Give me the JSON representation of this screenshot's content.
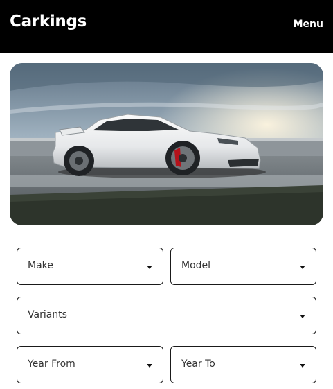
{
  "header": {
    "logo": "Carkings",
    "menu_label": "Menu",
    "background": "#000000"
  },
  "hero": {
    "image": "white-sports-car-on-race-track"
  },
  "filters": {
    "make": {
      "label": "Make"
    },
    "model": {
      "label": "Model"
    },
    "variants": {
      "label": "Variants"
    },
    "year_from": {
      "label": "Year From"
    },
    "year_to": {
      "label": "Year To"
    }
  }
}
